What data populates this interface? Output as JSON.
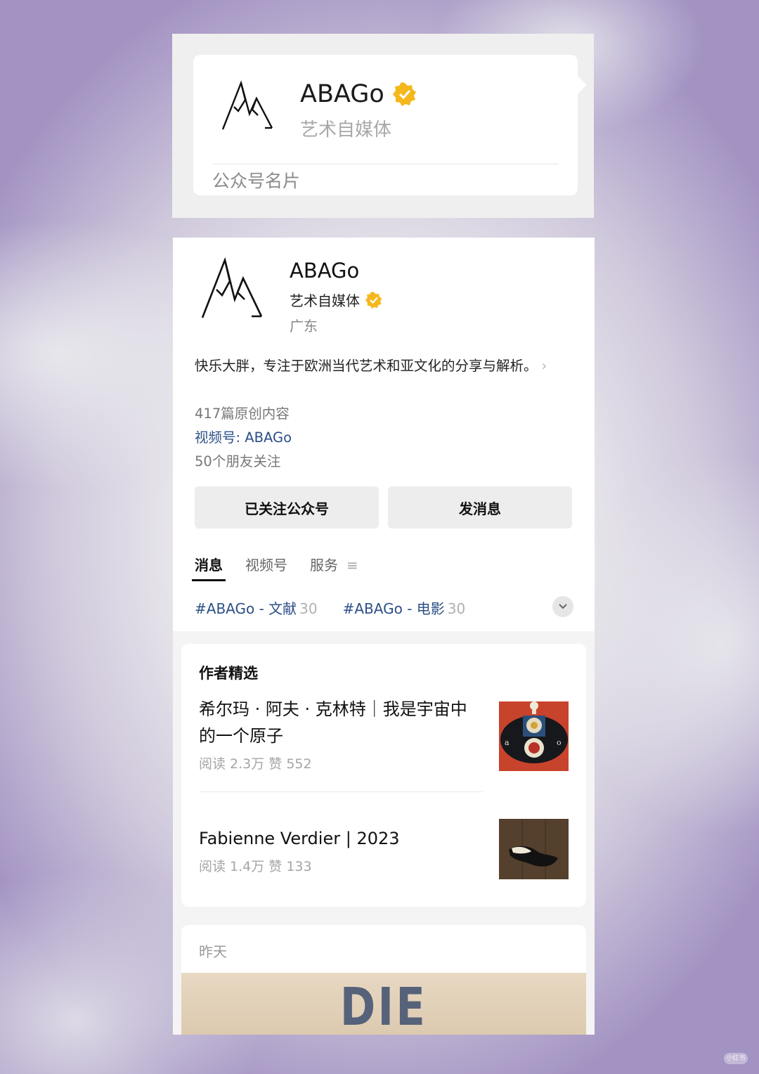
{
  "share_card": {
    "name": "ABAGo",
    "subtitle": "艺术自媒体",
    "footer": "公众号名片"
  },
  "profile": {
    "name": "ABAGo",
    "type": "艺术自媒体",
    "location": "广东",
    "description": "快乐大胖，专注于欧洲当代艺术和亚文化的分享与解析。",
    "articles": "417篇原创内容",
    "channel": "视频号: ABAGo",
    "friends": "50个朋友关注",
    "follow_button": "已关注公众号",
    "message_button": "发消息",
    "accent_color": "#2c4f86",
    "verified_color": "#f5b81c"
  },
  "tabs": [
    "消息",
    "视频号",
    "服务"
  ],
  "tags": [
    {
      "label": "#ABAGo - 文献",
      "count": "30"
    },
    {
      "label": "#ABAGo - 电影",
      "count": "30"
    }
  ],
  "selection": {
    "title": "作者精选",
    "articles": [
      {
        "title": "希尔玛 · 阿夫 · 克林特｜我是宇宙中的一个原子",
        "stats": "阅读 2.3万  赞 552"
      },
      {
        "title": "Fabienne Verdier | 2023",
        "stats": "阅读 1.4万  赞 133"
      }
    ]
  },
  "feed": {
    "day": "昨天",
    "cover_text": "DIE SCHEUCHE"
  },
  "watermark": "小红书"
}
